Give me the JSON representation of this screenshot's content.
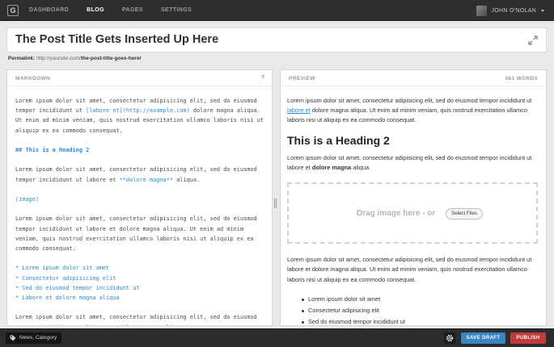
{
  "logo": "G",
  "nav": [
    {
      "label": "DASHBOARD",
      "active": false
    },
    {
      "label": "BLOG",
      "active": true
    },
    {
      "label": "PAGES",
      "active": false
    },
    {
      "label": "SETTINGS",
      "active": false
    }
  ],
  "user": {
    "name": "JOHN O'NOLAN"
  },
  "post": {
    "title": "The Post Title Gets Inserted Up Here",
    "permalink_label": "Permalink:",
    "permalink_base": "http://yoursite.com/",
    "permalink_slug": "the-post-title-goes-here/"
  },
  "markdown": {
    "label": "MARKDOWN",
    "help": "?",
    "para1_a": "Lorem ipsum dolor sit amet, consectetur adipisicing elit, sed do eiusmod tempor incididunt ut ",
    "para1_link": "[labore et](http://example.com)",
    "para1_b": " dolore magna aliqua. Ut enim ad minim veniam, quis nostrud exercitation ullamco laboris nisi ut aliquip ex ea commodo consequat.",
    "heading": "## This is a Heading 2",
    "para2_a": "Lorem ipsum dolor sit amet, consectetur adipisicing elit, sed do eiusmod tempor incididunt ut labore et ",
    "para2_bold": "**dolore magna**",
    "para2_b": " aliqua.",
    "image": "(image)",
    "para3": "Lorem ipsum dolor sit amet, consectetur adipisicing elit, sed do eiusmod tempor incididunt ut labore et dolore magna aliqua. Ut enim ad minim veniam, quis nostrud exercitation ullamco laboris nisi ut aliquip ex ea commodo consequat.",
    "list": [
      "* Lorem ipsum dolor sit amet",
      "* Consectetur adipisicing elit",
      "* Sed do eiusmod tempor incididunt ut",
      "* Labore et dolore magna aliqua"
    ],
    "para4": "Lorem ipsum dolor sit amet, consectetur adipisicing elit, sed do eiusmod tempor incididunt ut labore et dolore magna aliqua."
  },
  "preview": {
    "label": "PREVIEW",
    "word_count": "561 WORDS",
    "para1_a": "Lorem ipsum dolor sit amet, consectetur adipisicing elit, sed do eiusmod tempor incididunt ut ",
    "para1_link": "labore et",
    "para1_b": " dolore magna aliqua. Ut enim ad minim veniam, quis nostrud exercitation ullamco laboris nisi ut aliquip ex ea commodo consequat.",
    "heading": "This is a Heading 2",
    "para2_a": "Lorem ipsum dolor sit amet, consectetur adipisicing elit, sed do eiusmod tempor incididunt ut labore et ",
    "para2_bold": "dolore magna",
    "para2_b": " aliqua.",
    "drop_text": "Drag image here - or",
    "select_files": "Select Files",
    "para3": "Lorem ipsum dolor sit amet, consectetur adipisicing elit, sed do eiusmod tempor incididunt ut labore et dolore magna aliqua. Ut enim ad minim veniam, quis nostrud exercitation ullamco laboris nisi ut aliquip ex ea commodo consequat.",
    "list": [
      "Lorem ipsum dolor sit amet",
      "Consectetur adipisicing elit",
      "Sed do eiusmod tempor incididunt ut"
    ]
  },
  "footer": {
    "tags": "News, Category",
    "save_draft": "SAVE DRAFT",
    "publish": "PUBLISH"
  },
  "colors": {
    "accent_blue": "#3b85c4",
    "publish_red": "#c23b3b",
    "link_blue": "#2b8ad8"
  },
  "icons": [
    "logo-icon",
    "expand-icon",
    "help-icon",
    "tag-icon",
    "gear-icon",
    "caret-down-icon",
    "splitter-handle-icon"
  ]
}
